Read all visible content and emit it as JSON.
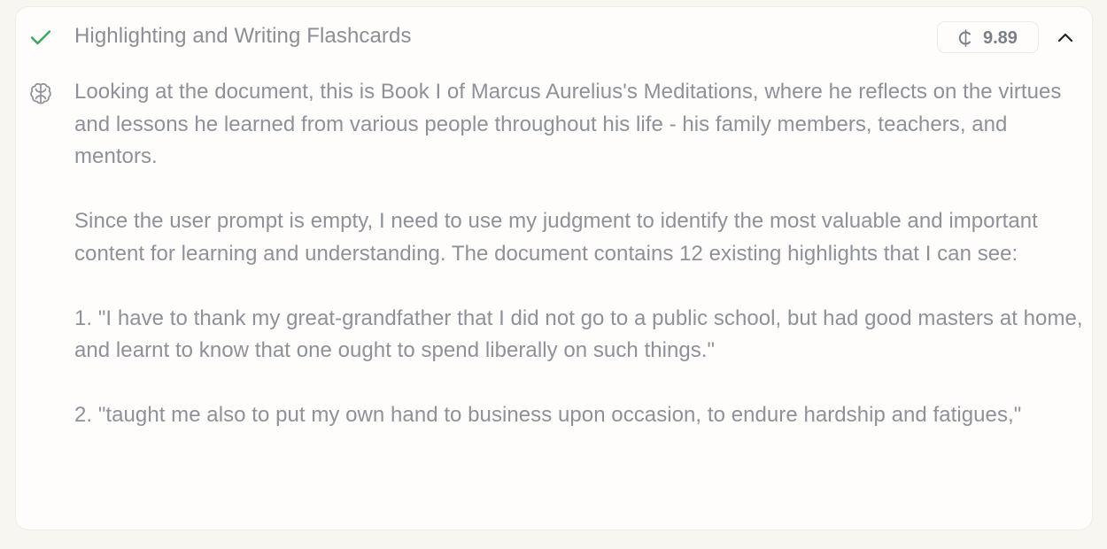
{
  "step": {
    "title": "Highlighting and Writing Flashcards",
    "status_icon": "check-icon",
    "cost": {
      "icon": "coin-icon",
      "value": "9.89"
    },
    "collapse_icon": "chevron-up-icon"
  },
  "thinking": {
    "icon": "brain-icon",
    "paragraphs": [
      "Looking at the document, this is Book I of Marcus Aurelius's Meditations, where he reflects on the virtues and lessons he learned from various people throughout his life - his family members, teachers, and mentors.",
      "Since the user prompt is empty, I need to use my judgment to identify the most valuable and important content for learning and understanding. The document contains 12 existing highlights that I can see:",
      "1. \"I have to thank my great-grandfather that I did not go to a public school, but had good masters at home, and learnt to know that one ought to spend liberally on such things.\"",
      "2. \"taught me also to put my own hand to business upon occasion, to endure hardship and fatigues,\""
    ]
  },
  "colors": {
    "check": "#3aa55d",
    "text": "#8e9199",
    "title": "#8b8e94",
    "background": "#f8f6f1",
    "card": "#fffdfb"
  }
}
